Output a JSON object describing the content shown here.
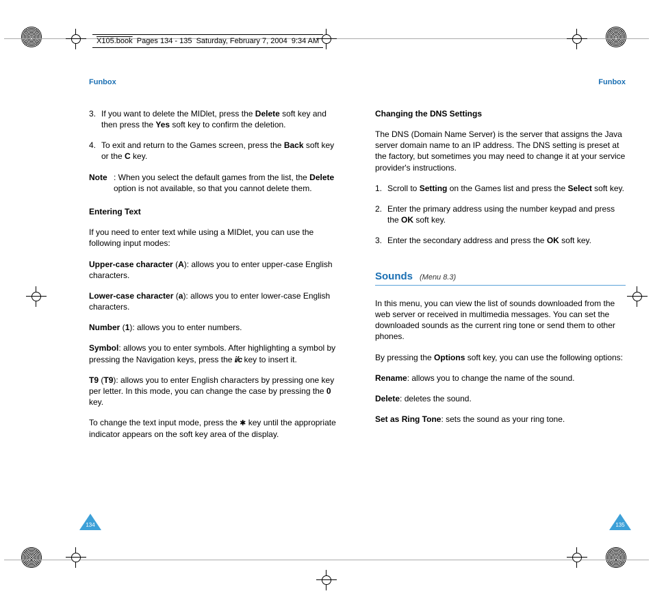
{
  "page_header": {
    "book": "X105.book",
    "pages": "Pages 134 - 135",
    "date": "Saturday, February 7, 2004",
    "time": "9:34 AM"
  },
  "left": {
    "section": "Funbox",
    "item3": {
      "num": "3.",
      "pre": "If you want to delete the MIDlet, press the ",
      "b1": "Delete",
      "mid": " soft key and then press the ",
      "b2": "Yes",
      "post": " soft key to confirm the deletion."
    },
    "item4": {
      "num": "4.",
      "pre": "To exit and return to the Games screen, press the ",
      "b1": "Back",
      "mid": " soft key or the ",
      "b2": "C",
      "post": " key."
    },
    "note": {
      "label": "Note",
      "pre": ": When you select the default games from the list, the ",
      "b1": "Delete",
      "post": " option is not available, so that you cannot delete them."
    },
    "heading_entering": "Entering Text",
    "intro": "If you need to enter text while using a MIDlet, you can use the following input modes:",
    "upper": {
      "lbl": "Upper-case character",
      "paren1": " (",
      "b": "A",
      "paren2": "): allows you to enter upper-case English characters."
    },
    "lower": {
      "lbl": "Lower-case character",
      "paren1": " (",
      "b": "a",
      "paren2": "): allows you to enter lower-case English characters."
    },
    "number": {
      "lbl": "Number",
      "paren1": " (",
      "b": "1",
      "paren2": "): allows you to enter numbers."
    },
    "symbol": {
      "lbl": "Symbol",
      "pre": ": allows you to enter symbols. After highlighting a symbol by pressing the Navigation keys, press the  ",
      "icon": "i/c",
      "post": " key to insert it."
    },
    "t9": {
      "lbl": "T9",
      "paren1": " (",
      "b": "T9",
      "mid": "): allows you to enter English characters by pressing one key per letter. In this mode, you can change the case by pressing the ",
      "b2": "0",
      "post": " key."
    },
    "change_mode": {
      "pre": "To change the text input mode, press the ",
      "icon": "✱",
      "post": " key until the appropriate indicator appears on the soft key area of the display."
    },
    "page_num": "134"
  },
  "right": {
    "section": "Funbox",
    "heading_dns": "Changing the DNS Settings",
    "dns_intro": "The DNS (Domain Name Server) is the server that assigns the Java server domain name to an IP address. The DNS setting is preset at the factory, but sometimes you may need to change it at your service provider's instructions.",
    "s1": {
      "num": "1.",
      "pre": "Scroll to ",
      "b1": "Setting",
      "mid": " on the Games list and press the ",
      "b2": "Select",
      "post": " soft key."
    },
    "s2": {
      "num": "2.",
      "pre": "Enter the primary address using the number keypad and press the ",
      "b1": "OK",
      "post": " soft key."
    },
    "s3": {
      "num": "3.",
      "pre": "Enter the secondary address and press the ",
      "b1": "OK",
      "post": " soft key."
    },
    "sounds_heading": "Sounds",
    "sounds_menu": "(Menu 8.3)",
    "sounds_intro": "In this menu, you can view the list of sounds downloaded from the web server or received in multimedia messages. You can set the downloaded sounds as the current ring tone or send them to other phones.",
    "options_intro": {
      "pre": "By pressing the ",
      "b": "Options",
      "post": " soft key, you can use the following options:"
    },
    "rename": {
      "lbl": "Rename",
      "post": ": allows you to change the name of the sound."
    },
    "delete": {
      "lbl": "Delete",
      "post": ": deletes the sound."
    },
    "ringtone": {
      "lbl": "Set as Ring Tone",
      "post": ": sets the sound as your ring tone."
    },
    "page_num": "135"
  }
}
